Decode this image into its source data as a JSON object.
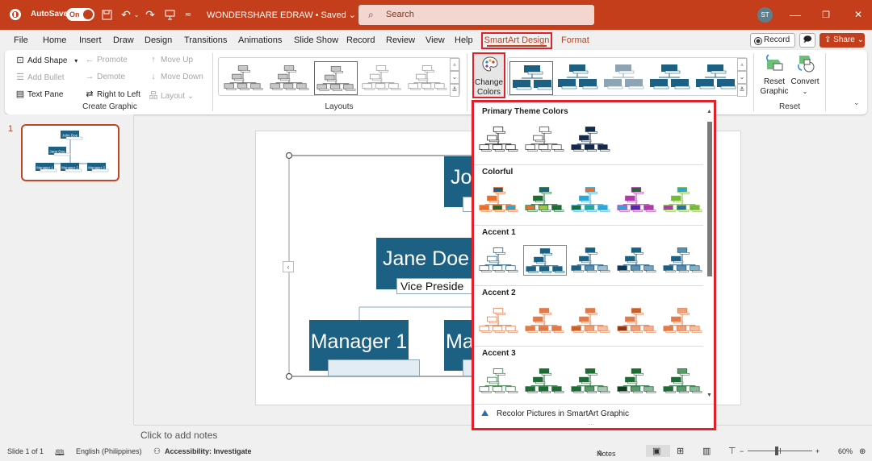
{
  "titlebar": {
    "autosave_label": "AutoSave",
    "autosave_state": "On",
    "document_title": "WONDERSHARE EDRAW • Saved ⌄",
    "search_placeholder": "Search",
    "user_initials": "ST",
    "icons": [
      "powerpoint-logo-icon",
      "save-icon",
      "undo-icon",
      "redo-icon",
      "present-icon",
      "customize-qat-icon"
    ],
    "window_controls": {
      "minimize": "—",
      "restore": "❐",
      "close": "✕"
    }
  },
  "menu": {
    "tabs": [
      "File",
      "Home",
      "Insert",
      "Draw",
      "Design",
      "Transitions",
      "Animations",
      "Slide Show",
      "Record",
      "Review",
      "View",
      "Help",
      "SmartArt Design",
      "Format"
    ],
    "active_tab": "SmartArt Design",
    "record_label": "Record",
    "share_label": "Share ⌄"
  },
  "ribbon": {
    "create_graphic": {
      "label": "Create Graphic",
      "add_shape": "Add Shape",
      "add_bullet": "Add Bullet",
      "text_pane": "Text Pane",
      "promote": "Promote",
      "demote": "Demote",
      "right_to_left": "Right to Left",
      "move_up": "Move Up",
      "move_down": "Move Down",
      "layout": "Layout ⌄"
    },
    "layouts": {
      "label": "Layouts",
      "selected_index": 2,
      "count": 5
    },
    "change_colors": {
      "line1": "Change",
      "line2": "Colors ⌄"
    },
    "styles": {
      "count": 5,
      "selected_index": 0
    },
    "reset": {
      "label": "Reset",
      "reset_graphic_1": "Reset",
      "reset_graphic_2": "Graphic",
      "convert": "Convert",
      "convert_arrow": "⌄"
    }
  },
  "slides_pane": {
    "slide_number": "1",
    "thumb_texts": [
      "John Doe",
      "Jane Doe",
      "Manager 1",
      "Manager 2",
      "Manager 3"
    ]
  },
  "slide": {
    "top_box": "Jo",
    "jane_box": "Jane Doe",
    "jane_title": "Vice Preside",
    "manager1": "Manager 1",
    "manager2": "Ma",
    "text_pane_toggle": "‹"
  },
  "color_dropdown": {
    "sections": [
      {
        "title": "Primary Theme Colors",
        "variants": [
          {
            "top": "#ffffff",
            "mid": "#ffffff",
            "bot": [
              "#ffffff",
              "#ffffff",
              "#ffffff"
            ],
            "line": "#222222"
          },
          {
            "top": "#ffffff",
            "mid": "#ffffff",
            "bot": [
              "#ffffff",
              "#ffffff",
              "#ffffff"
            ],
            "line": "#444444"
          },
          {
            "top": "#152a4a",
            "mid": "#152a4a",
            "bot": [
              "#152a4a",
              "#152a4a",
              "#152a4a"
            ],
            "line": "#152a4a"
          }
        ]
      },
      {
        "title": "Colorful",
        "variants": [
          {
            "top": "#1c6184",
            "mid": "#e8702a",
            "bot": [
              "#e8702a",
              "#1e6b35",
              "#2aa6d8"
            ],
            "line": "#e8702a"
          },
          {
            "top": "#1c6184",
            "mid": "#1e6b35",
            "bot": [
              "#e8702a",
              "#a8c43a",
              "#1e6b35"
            ],
            "line": "#1e6b35"
          },
          {
            "top": "#e8702a",
            "mid": "#2aa6d8",
            "bot": [
              "#1e6b35",
              "#2aa68a",
              "#2aa6d8"
            ],
            "line": "#2aa6d8"
          },
          {
            "top": "#1e6b35",
            "mid": "#b03aa8",
            "bot": [
              "#2aa6d8",
              "#4a2ab0",
              "#b03aa8"
            ],
            "line": "#b03aa8"
          },
          {
            "top": "#2aa6d8",
            "mid": "#7ab83a",
            "bot": [
              "#b03aa8",
              "#2a6ab0",
              "#7ab83a"
            ],
            "line": "#7ab83a"
          }
        ]
      },
      {
        "title": "Accent 1",
        "variants": [
          {
            "top": "#ffffff",
            "mid": "#ffffff",
            "bot": [
              "#ffffff",
              "#ffffff",
              "#ffffff"
            ],
            "line": "#1c6184"
          },
          {
            "top": "#1c6184",
            "mid": "#1c6184",
            "bot": [
              "#1c6184",
              "#1c6184",
              "#1c6184"
            ],
            "line": "#1c6184"
          },
          {
            "top": "#1c6184",
            "mid": "#1c6184",
            "bot": [
              "#1c6184",
              "#5a8fb0",
              "#a5bfd0"
            ],
            "line": "#1c6184"
          },
          {
            "top": "#1c6184",
            "mid": "#1c6184",
            "bot": [
              "#0f3550",
              "#5a8fb0",
              "#7aa5c0"
            ],
            "line": "#1c6184"
          },
          {
            "top": "#5a8fb0",
            "mid": "#1c6184",
            "bot": [
              "#1c6184",
              "#5a8fb0",
              "#8ab0c8"
            ],
            "line": "#1c6184"
          }
        ]
      },
      {
        "title": "Accent 2",
        "variants": [
          {
            "top": "#ffffff",
            "mid": "#ffffff",
            "bot": [
              "#ffffff",
              "#ffffff",
              "#ffffff"
            ],
            "line": "#e07a48"
          },
          {
            "top": "#e07a48",
            "mid": "#e07a48",
            "bot": [
              "#e07a48",
              "#e07a48",
              "#e07a48"
            ],
            "line": "#e07a48"
          },
          {
            "top": "#e07a48",
            "mid": "#e07a48",
            "bot": [
              "#c8602a",
              "#e8a07a",
              "#f0c0a8"
            ],
            "line": "#e07a48"
          },
          {
            "top": "#c8602a",
            "mid": "#e07a48",
            "bot": [
              "#8a3a1a",
              "#e8a07a",
              "#f0b090"
            ],
            "line": "#e07a48"
          },
          {
            "top": "#eaa07a",
            "mid": "#e07a48",
            "bot": [
              "#e07a48",
              "#eaa07a",
              "#f0c0a8"
            ],
            "line": "#e07a48"
          }
        ]
      },
      {
        "title": "Accent 3",
        "variants": [
          {
            "top": "#ffffff",
            "mid": "#ffffff",
            "bot": [
              "#ffffff",
              "#ffffff",
              "#ffffff"
            ],
            "line": "#2a7a3a"
          },
          {
            "top": "#1e6b35",
            "mid": "#1e6b35",
            "bot": [
              "#1e6b35",
              "#1e6b35",
              "#1e6b35"
            ],
            "line": "#1e6b35"
          },
          {
            "top": "#1e6b35",
            "mid": "#1e6b35",
            "bot": [
              "#1e6b35",
              "#5a9a6a",
              "#a8c8b0"
            ],
            "line": "#1e6b35"
          },
          {
            "top": "#1e6b35",
            "mid": "#1e6b35",
            "bot": [
              "#0f3a1c",
              "#5a9a6a",
              "#8ab89a"
            ],
            "line": "#1e6b35"
          },
          {
            "top": "#5a9a6a",
            "mid": "#1e6b35",
            "bot": [
              "#1e6b35",
              "#5a9a6a",
              "#8ab89a"
            ],
            "line": "#1e6b35"
          }
        ]
      }
    ],
    "selected": {
      "section": 2,
      "index": 1
    },
    "recolor_label": "Recolor Pictures in SmartArt Graphic",
    "resize_grip": "....",
    "scroll_up": "▲",
    "scroll_down": "▼"
  },
  "notes": {
    "placeholder": "Click to add notes"
  },
  "statusbar": {
    "slide_info": "Slide 1 of 1",
    "language": "English (Philippines)",
    "accessibility": "Accessibility: Investigate",
    "notes_label": "Notes",
    "zoom_level": "60%",
    "zoom_fraction": 0.45
  },
  "colors": {
    "accent": "#c43e1c",
    "smartart_blue": "#1c6184",
    "highlight_red": "#e0202a"
  }
}
